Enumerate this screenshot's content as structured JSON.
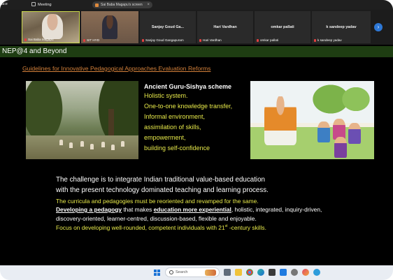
{
  "meeting_bar": {
    "app_name": "ace",
    "meeting_label": "Meeting",
    "share_label": "Sai Baba Magapu's screen",
    "close_glyph": "×",
    "icon_meeting": "meeting-icon",
    "icon_share": "screen-share-icon"
  },
  "participants": [
    {
      "name": "Sai Baba Magapu",
      "display": "video",
      "mic": "muted"
    },
    {
      "name": "SIT HYD",
      "display": "video",
      "mic": "muted"
    },
    {
      "name": "Sanjay Goud Gangapuram",
      "title": "Sanjay Goud Ga...",
      "display": "name",
      "mic": "muted"
    },
    {
      "name": "Hari Vardhan",
      "title": "Hari Vardhan",
      "display": "name",
      "mic": "muted"
    },
    {
      "name": "omkar pallati",
      "title": "omkar pallati",
      "display": "name",
      "mic": "muted"
    },
    {
      "name": "k sandeep yadav",
      "title": "k sandeep yadav",
      "display": "name",
      "mic": "muted"
    }
  ],
  "next_button_glyph": "›",
  "slide": {
    "title": "NEP@4 and Beyond",
    "guideline": "Guidelines for Innovative Pedagogical Approaches Evaluation Reforms",
    "scheme_heading": "Ancient Guru-Sishya scheme",
    "scheme_points": [
      "Holistic system.",
      "One-to-one  knowledge  transfer,",
      "Informal environment,",
      "assimilation of skills,",
      "empowerment,",
      "building self-confidence"
    ],
    "challenge_line1": "The challenge is to integrate Indian traditional value-based education",
    "challenge_line2": "with the present technology dominated teaching and learning process.",
    "yellow_line1": "The curricula and pedagogies must be reoriented and revamped for the same.",
    "pedagogy_prefix": "Developing a pedagogy",
    "pedagogy_mid": " that makes ",
    "pedagogy_emph": "education more experiential",
    "pedagogy_rest": ", holistic, integrated, inquiry-driven,",
    "white_line2": "discovery-oriented, learner-centred, discussion-based, flexible and enjoyable.",
    "focus_prefix": "Focus on developing well-rounded, competent individuals with 21",
    "focus_sup": "st",
    "focus_suffix": " -century skills."
  },
  "taskbar": {
    "search_placeholder": "Search",
    "icons": [
      "windows-start-icon",
      "search-icon",
      "task-view-icon",
      "file-explorer-icon",
      "chrome-icon",
      "edge-icon",
      "store-icon",
      "mail-icon",
      "settings-icon",
      "chat-icon"
    ]
  },
  "colors": {
    "slide_bg": "#000000",
    "title_bar": "#1e3d12",
    "guideline": "#d3803a",
    "accent_yellow": "#e8ea4a",
    "speaker_border": "#c9d64a",
    "next_button": "#2e78d6"
  }
}
